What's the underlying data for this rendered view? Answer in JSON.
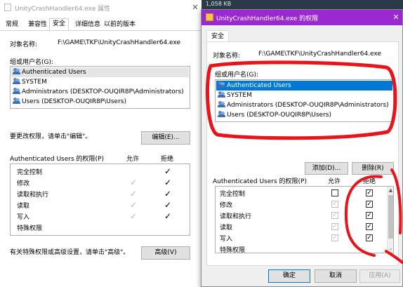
{
  "background_dialog": {
    "title": "UnityCrashHandler64.exe 属性",
    "close_glyph": "✕",
    "tabs": [
      "常规",
      "兼容性",
      "安全",
      "详细信息",
      "以前的版本"
    ],
    "active_tab": "安全",
    "object_name_label": "对象名称:",
    "object_name_value": "F:\\GAME\\TKF\\UnityCrashHandler64.exe",
    "group_label": "组或用户名(G):",
    "groups": [
      "Authenticated Users",
      "SYSTEM",
      "Administrators (DESKTOP-OUQIR8P\\Administrators)",
      "Users (DESKTOP-OUQIR8P\\Users)"
    ],
    "edit_hint": "要更改权限，请单击\"编辑\"。",
    "edit_button": "编辑(E)...",
    "perm_header": "Authenticated Users 的权限(P)",
    "allow_header": "允许",
    "deny_header": "拒绝",
    "permissions": [
      "完全控制",
      "修改",
      "读取和执行",
      "读取",
      "写入",
      "特殊权限"
    ],
    "allow_checks": [
      false,
      true,
      true,
      true,
      true,
      false
    ],
    "deny_checks": [
      true,
      true,
      true,
      true,
      true,
      false
    ],
    "advanced_hint": "有关特殊权限或高级设置，请单击\"高级\"。",
    "advanced_button": "高级(V)"
  },
  "background_strip": {
    "size_text": "1,058 KB"
  },
  "foreground_dialog": {
    "title": "UnityCrashHandler64.exe 的权限",
    "close_glyph": "✕",
    "tab": "安全",
    "object_name_label": "对象名称:",
    "object_name_value": "F:\\GAME\\TKF\\UnityCrashHandler64.exe",
    "group_label": "组或用户名(G):",
    "groups": [
      "Authenticated Users",
      "SYSTEM",
      "Administrators (DESKTOP-OUQIR8P\\Administrators)",
      "Users (DESKTOP-OUQIR8P\\Users)"
    ],
    "selected_group_index": 0,
    "add_button": "添加(D)...",
    "remove_button": "删除(R)",
    "perm_header": "Authenticated Users 的权限(P)",
    "allow_header": "允许",
    "deny_header": "拒绝",
    "permissions": [
      "完全控制",
      "修改",
      "读取和执行",
      "读取",
      "写入",
      "特殊权限"
    ],
    "allow_checks": [
      false,
      true,
      true,
      true,
      true,
      false
    ],
    "deny_checks": [
      true,
      true,
      true,
      true,
      true,
      false
    ],
    "ok_button": "确定",
    "cancel_button": "取消",
    "apply_button": "应用(A)"
  },
  "colors": {
    "title_accent": "#9a2ad0",
    "selection": "#0078d7",
    "annotation_red": "#e8141c"
  }
}
